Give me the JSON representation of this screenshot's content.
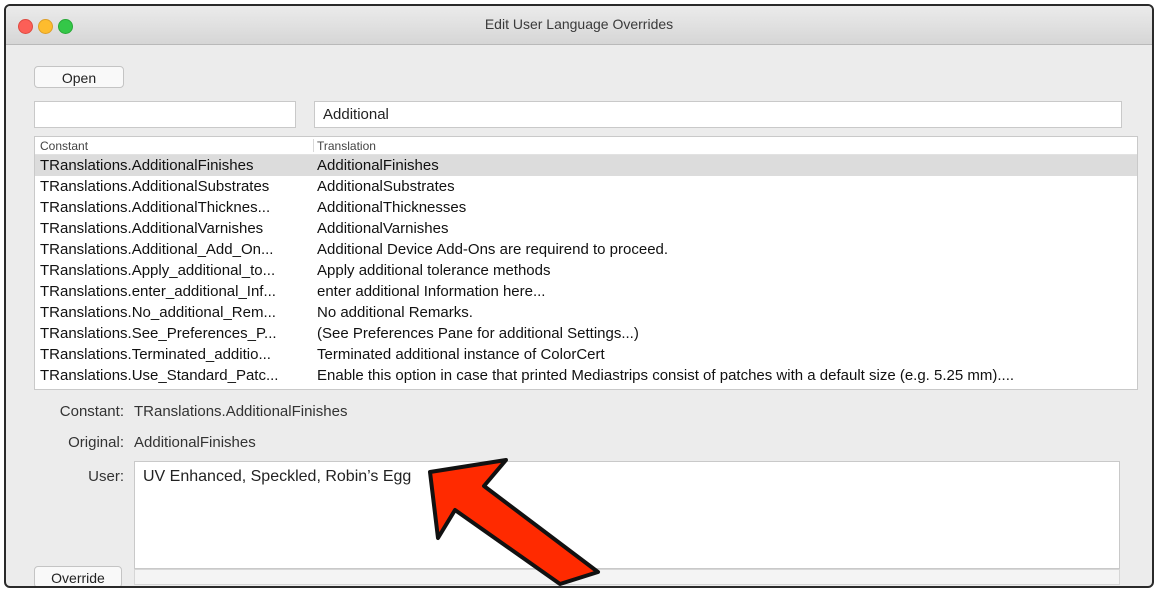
{
  "window": {
    "title": "Edit User Language Overrides"
  },
  "toolbar": {
    "open_label": "Open",
    "override_label": "Override"
  },
  "filters": {
    "constant_value": "",
    "translation_value": "Additional"
  },
  "table": {
    "headers": {
      "constant": "Constant",
      "translation": "Translation"
    },
    "rows": [
      {
        "constant": "TRanslations.AdditionalFinishes",
        "translation": "AdditionalFinishes",
        "selected": true
      },
      {
        "constant": "TRanslations.AdditionalSubstrates",
        "translation": "AdditionalSubstrates"
      },
      {
        "constant": "TRanslations.AdditionalThicknes...",
        "translation": "AdditionalThicknesses"
      },
      {
        "constant": "TRanslations.AdditionalVarnishes",
        "translation": "AdditionalVarnishes"
      },
      {
        "constant": "TRanslations.Additional_Add_On...",
        "translation": "Additional Device Add-Ons are requirend to proceed."
      },
      {
        "constant": "TRanslations.Apply_additional_to...",
        "translation": "Apply additional tolerance methods"
      },
      {
        "constant": "TRanslations.enter_additional_Inf...",
        "translation": "enter additional Information here..."
      },
      {
        "constant": "TRanslations.No_additional_Rem...",
        "translation": "No additional Remarks."
      },
      {
        "constant": "TRanslations.See_Preferences_P...",
        "translation": "(See Preferences Pane for additional Settings...)"
      },
      {
        "constant": "TRanslations.Terminated_additio...",
        "translation": "Terminated additional instance of ColorCert"
      },
      {
        "constant": "TRanslations.Use_Standard_Patc...",
        "translation": "Enable this option in case that printed Mediastrips consist of patches with a default size (e.g. 5.25 mm)...."
      }
    ]
  },
  "details": {
    "constant_label": "Constant:",
    "constant_value": "TRanslations.AdditionalFinishes",
    "original_label": "Original:",
    "original_value": "AdditionalFinishes",
    "user_label": "User:",
    "user_value": "UV Enhanced, Speckled, Robin’s Egg"
  },
  "annotation": {
    "arrow_color": "#ff2a00",
    "icon": "red-pointer-arrow-icon"
  }
}
